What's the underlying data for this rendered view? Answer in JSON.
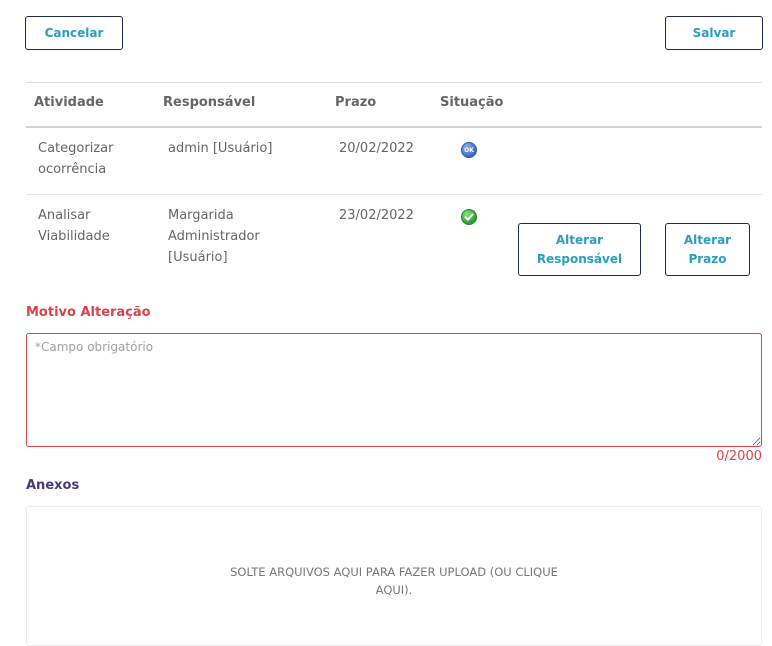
{
  "toolbar": {
    "cancel_label": "Cancelar",
    "save_label": "Salvar"
  },
  "table": {
    "columns": [
      "Atividade",
      "Responsável",
      "Prazo",
      "Situação"
    ],
    "rows": [
      {
        "activity": [
          "Categorizar",
          "ocorrência"
        ],
        "responsible": [
          "admin [Usuário]"
        ],
        "deadline": "20/02/2022",
        "status_icon": "ok-circle-icon"
      },
      {
        "activity": [
          "Analisar",
          "Viabilidade"
        ],
        "responsible": [
          "Margarida",
          "Administrador",
          "[Usuário]"
        ],
        "deadline": "23/02/2022",
        "status_icon": "check-circle-icon",
        "actions": {
          "change_responsible": [
            "Alterar",
            "Responsável"
          ],
          "change_deadline": [
            "Alterar",
            "Prazo"
          ]
        }
      }
    ]
  },
  "reason": {
    "label": "Motivo Alteração",
    "placeholder": "*Campo obrigatório",
    "value": "",
    "counter": "0/2000"
  },
  "attachments": {
    "label": "Anexos",
    "dropzone_text": [
      "SOLTE ARQUIVOS AQUI PARA FAZER UPLOAD (OU CLIQUE",
      "AQUI)."
    ]
  },
  "colors": {
    "accent": "#2a9fbf",
    "error": "#d9434e",
    "section_label": "#4a3a7a",
    "button_border": "#1f2a44"
  }
}
